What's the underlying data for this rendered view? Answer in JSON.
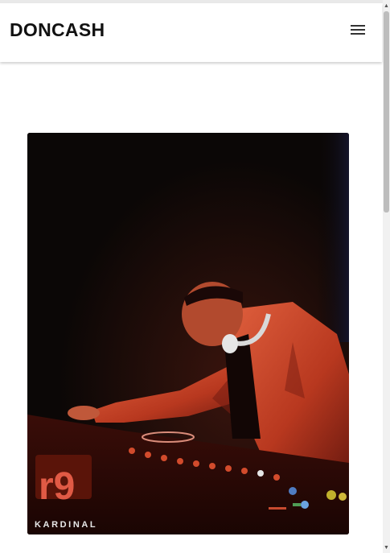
{
  "header": {
    "brand": "DONCASH",
    "menu_icon": "hamburger-menu-icon"
  },
  "hero": {
    "image_content": "DJ in orange denim jacket wearing headphones, mixing on a lit DJ console in a dark club",
    "watermark": "KARDINAL"
  },
  "colors": {
    "background": "#ffffff",
    "brand_text": "#111111",
    "photo_dark": "#0b0706",
    "photo_accent": "#c8432a"
  }
}
